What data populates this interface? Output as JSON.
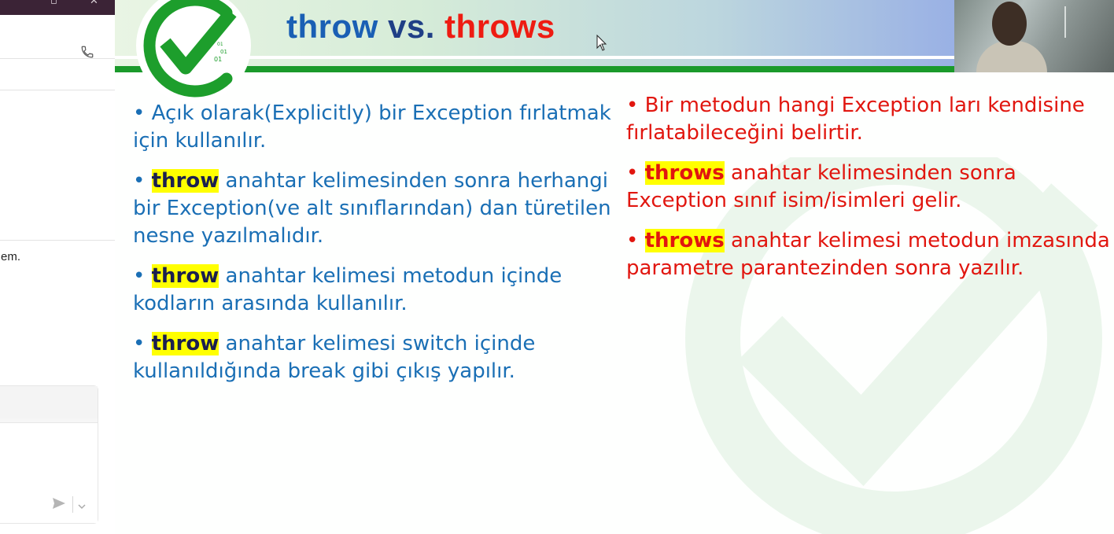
{
  "sidebar": {
    "snippet_text": "em.",
    "icons": {
      "call": "phone-icon",
      "send": "send-icon",
      "more": "chevron-down-icon"
    }
  },
  "slide": {
    "title": {
      "part1": "throw",
      "part2": "vs.",
      "part3": "throws"
    },
    "logo_bits": [
      "01",
      "01",
      "01"
    ],
    "colors": {
      "blue": "#1a6fb5",
      "red": "#e1160f",
      "highlight": "#ffff00",
      "green": "#1a9a2b"
    },
    "left_bullets": [
      {
        "bullet": "•",
        "keyword": "",
        "text": "Açık olarak(Explicitly) bir Exception fırlatmak için kullanılır."
      },
      {
        "bullet": "•",
        "keyword": "throw",
        "text": "anahtar kelimesinden sonra herhangi bir Exception(ve alt sınıflarından) dan türetilen nesne yazılmalıdır."
      },
      {
        "bullet": "•",
        "keyword": "throw",
        "text": "anahtar kelimesi metodun içinde kodların arasında kullanılır."
      },
      {
        "bullet": "•",
        "keyword": "throw",
        "text": "anahtar kelimesi switch içinde kullanıldığında break gibi çıkış yapılır."
      }
    ],
    "right_bullets": [
      {
        "bullet": "•",
        "keyword": "",
        "text": "Bir metodun hangi Exception ları kendisine fırlatabileceğini belirtir."
      },
      {
        "bullet": "•",
        "keyword": "throws",
        "text": "anahtar kelimesinden sonra Exception sınıf isim/isimleri gelir."
      },
      {
        "bullet": "•",
        "keyword": "throws",
        "text": "anahtar kelimesi metodun imzasında parametre parantezinden sonra yazılır."
      }
    ]
  }
}
